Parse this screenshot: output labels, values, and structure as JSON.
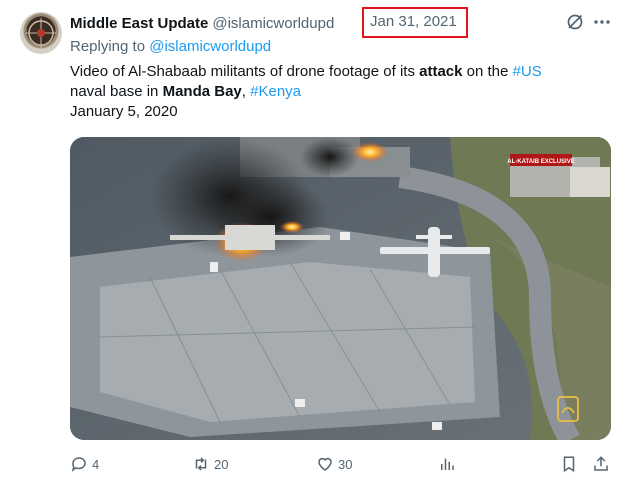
{
  "author": {
    "name": "Middle East Update",
    "handle": "@islamicworldupd",
    "date": "Jan 31, 2021"
  },
  "reply": {
    "prefix": "Replying to",
    "handle": "@islamicworldupd"
  },
  "body": {
    "t1": "Video of Al-Shabaab militants of drone footage of its ",
    "attack": "attack",
    "t2": " on the ",
    "hashtag_us": "#US",
    "t3": "naval base in ",
    "manda_bay": "Manda Bay",
    "t4": ", ",
    "hashtag_kenya": "#Kenya",
    "line3": "January 5, 2020"
  },
  "media": {
    "overlay_label": "AL-KATAIB EXCLUSIVE"
  },
  "actions": {
    "replies": "4",
    "reposts": "20",
    "likes": "30"
  },
  "colors": {
    "link": "#1d9bf0",
    "secondary": "#536471",
    "highlight_box": "#e0161e"
  },
  "icons": [
    "grok-icon",
    "more-icon",
    "reply-icon",
    "repost-icon",
    "like-icon",
    "views-icon",
    "bookmark-icon",
    "share-icon"
  ]
}
